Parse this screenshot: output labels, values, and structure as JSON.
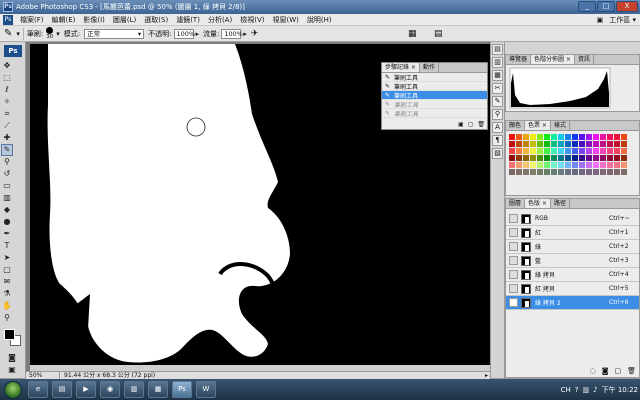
{
  "window": {
    "title": "Adobe Photoshop CS3 - [馬麗芭蕾.psd @ 50% (圖層 1, 綠 拷貝 2/8)]",
    "min": "_",
    "max": "□",
    "close": "X"
  },
  "menu": {
    "items": [
      "檔案(F)",
      "編輯(E)",
      "影像(I)",
      "圖層(L)",
      "選取(S)",
      "濾鏡(T)",
      "分析(A)",
      "檢視(V)",
      "視窗(W)",
      "說明(H)"
    ],
    "workspace": "工作區 ▾"
  },
  "options": {
    "brush_label": "筆刷:",
    "brush_size": "30",
    "mode_label": "模式:",
    "mode_value": "正常",
    "opacity_label": "不透明:",
    "opacity_value": "100%",
    "flow_label": "流量:",
    "flow_value": "100%"
  },
  "status": {
    "zoom": "50%",
    "doc_info": "91.44 公分 x 68.3 公分 (72 ppi)"
  },
  "history": {
    "tabs": [
      "步驟記錄 ×",
      "動作"
    ],
    "items": [
      {
        "label": "筆刷工具",
        "state": "normal"
      },
      {
        "label": "筆刷工具",
        "state": "normal"
      },
      {
        "label": "筆刷工具",
        "state": "active"
      },
      {
        "label": "筆刷工具",
        "state": "dim"
      },
      {
        "label": "筆刷工具",
        "state": "dim"
      }
    ]
  },
  "navigator": {
    "tabs": [
      "導覽器",
      "色階分佈圖 ×",
      "資訊"
    ]
  },
  "swatches": {
    "tabs": [
      "顏色",
      "色票 ×",
      "樣式"
    ]
  },
  "channels": {
    "tabs": [
      "圖層",
      "色版 ×",
      "路徑"
    ],
    "rows": [
      {
        "name": "RGB",
        "key": "Ctrl+~",
        "active": false
      },
      {
        "name": "紅",
        "key": "Ctrl+1",
        "active": false
      },
      {
        "name": "綠",
        "key": "Ctrl+2",
        "active": false
      },
      {
        "name": "藍",
        "key": "Ctrl+3",
        "active": false
      },
      {
        "name": "綠 拷貝",
        "key": "Ctrl+4",
        "active": false
      },
      {
        "name": "紅 拷貝",
        "key": "Ctrl+5",
        "active": false
      },
      {
        "name": "綠 拷貝 2",
        "key": "Ctrl+6",
        "active": true
      }
    ]
  },
  "taskbar": {
    "lang": "CH",
    "time": "下午 10:22"
  },
  "colors": {
    "accent": "#3b8de6",
    "canvas_bg": "#000000",
    "mask": "#ffffff"
  }
}
